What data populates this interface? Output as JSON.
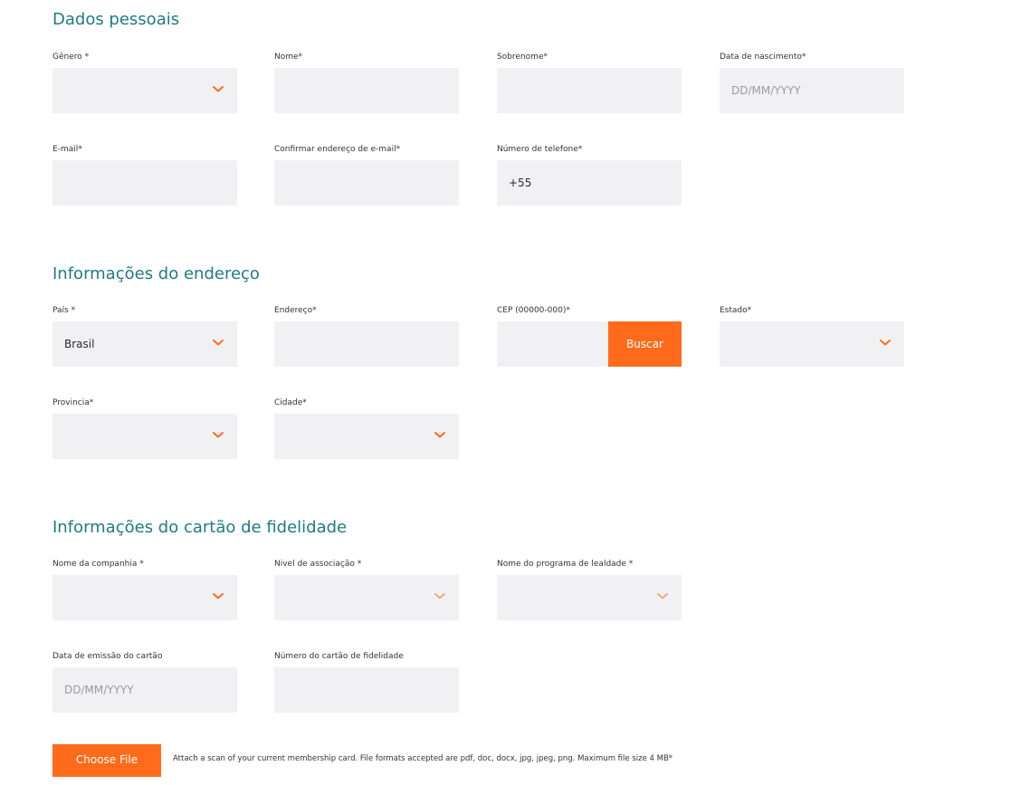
{
  "sections": {
    "personal": {
      "title": "Dados pessoais",
      "gender": {
        "label": "Gênero *",
        "value": ""
      },
      "first_name": {
        "label": "Nome*",
        "value": ""
      },
      "last_name": {
        "label": "Sobrenome*",
        "value": ""
      },
      "birth_date": {
        "label": "Data de nascimento*",
        "placeholder": "DD/MM/YYYY"
      },
      "email": {
        "label": "E-mail*",
        "value": ""
      },
      "confirm_email": {
        "label": "Confirmar endereço de e-mail*",
        "value": ""
      },
      "phone": {
        "label": "Número de telefone*",
        "value": "+55"
      }
    },
    "address": {
      "title": "Informações do endereço",
      "country": {
        "label": "País *",
        "value": "Brasil"
      },
      "street": {
        "label": "Endereço*",
        "value": ""
      },
      "zip": {
        "label": "CEP (00000-000)*",
        "value": "",
        "button_label": "Buscar"
      },
      "state": {
        "label": "Estado*",
        "value": ""
      },
      "province": {
        "label": "Provincia*",
        "value": ""
      },
      "city": {
        "label": "Cidade*",
        "value": ""
      }
    },
    "loyalty": {
      "title": "Informações do cartão de fidelidade",
      "company_name": {
        "label": "Nome da companhia *",
        "value": ""
      },
      "membership_level": {
        "label": "Nivel de associação *",
        "value": ""
      },
      "program_name": {
        "label": "Nome do programa de lealdade *",
        "value": ""
      },
      "issue_date": {
        "label": "Data de emissão do cartão",
        "placeholder": "DD/MM/YYYY"
      },
      "card_number": {
        "label": "Número do cartão de fidelidade",
        "value": ""
      }
    }
  },
  "upload": {
    "button_label": "Choose File",
    "hint": "Attach a scan of your current membership card. File formats accepted are pdf, doc, docx, jpg, jpeg, png. Maximum file size 4 MB*"
  },
  "icons": {
    "dropdown": "chevron-down-icon"
  },
  "colors": {
    "accent": "#ff6b1a",
    "section_title": "#1f7a86",
    "field_background": "#f1f1f4"
  }
}
